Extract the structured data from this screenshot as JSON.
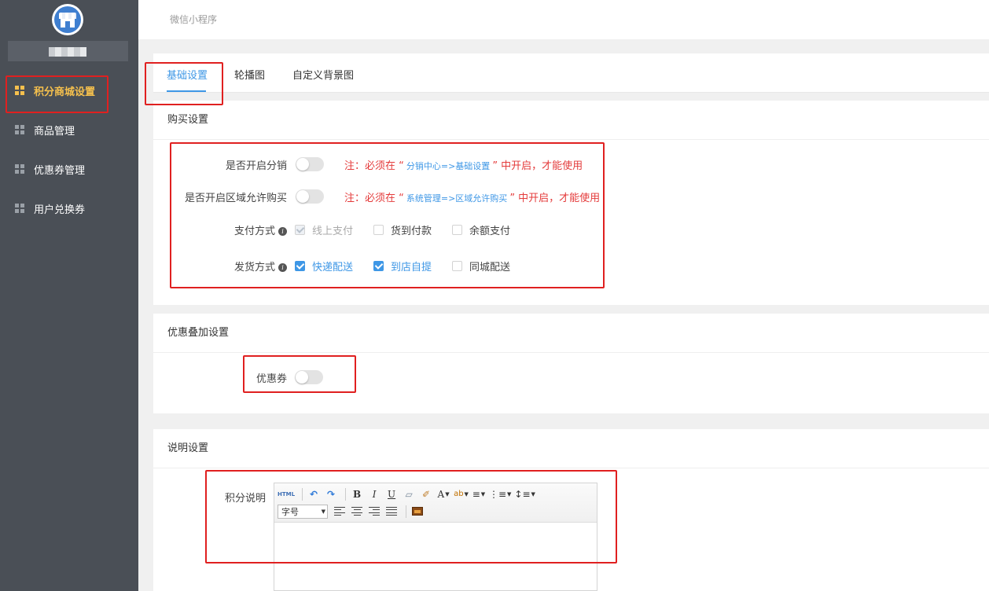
{
  "header": {
    "breadcrumb": "微信小程序"
  },
  "sidebar": {
    "items": [
      {
        "label": "积分商城设置",
        "active": true
      },
      {
        "label": "商品管理",
        "active": false
      },
      {
        "label": "优惠券管理",
        "active": false
      },
      {
        "label": "用户兑换券",
        "active": false
      }
    ]
  },
  "tabs": [
    {
      "label": "基础设置",
      "active": true
    },
    {
      "label": "轮播图",
      "active": false
    },
    {
      "label": "自定义背景图",
      "active": false
    }
  ],
  "purchase": {
    "title": "购买设置",
    "distribution": {
      "label": "是否开启分销",
      "enabled": false,
      "note_prefix": "注：必须在 “",
      "note_path": "分销中心=>基础设置",
      "note_suffix": "” 中开启，才能使用"
    },
    "region": {
      "label": "是否开启区域允许购买",
      "enabled": false,
      "note_prefix": "注：必须在 “",
      "note_path": "系统管理=>区域允许购买",
      "note_suffix": "” 中开启，才能使用"
    },
    "payment": {
      "label": "支付方式",
      "options": [
        {
          "label": "线上支付",
          "checked": true,
          "disabled": true
        },
        {
          "label": "货到付款",
          "checked": false
        },
        {
          "label": "余额支付",
          "checked": false
        }
      ]
    },
    "delivery": {
      "label": "发货方式",
      "options": [
        {
          "label": "快递配送",
          "checked": true
        },
        {
          "label": "到店自提",
          "checked": true
        },
        {
          "label": "同城配送",
          "checked": false
        }
      ]
    }
  },
  "discount": {
    "title": "优惠叠加设置",
    "coupon_label": "优惠券",
    "coupon_enabled": false
  },
  "description": {
    "title": "说明设置",
    "field_label": "积分说明",
    "editor": {
      "html_label": "HTML",
      "fontsize_label": "字号",
      "font_color_label": "A"
    }
  },
  "colors": {
    "accent": "#3e97e6",
    "sidebar_active": "#f5c04d",
    "sidebar_bg": "#4a4f56",
    "highlight": "#e02020"
  }
}
